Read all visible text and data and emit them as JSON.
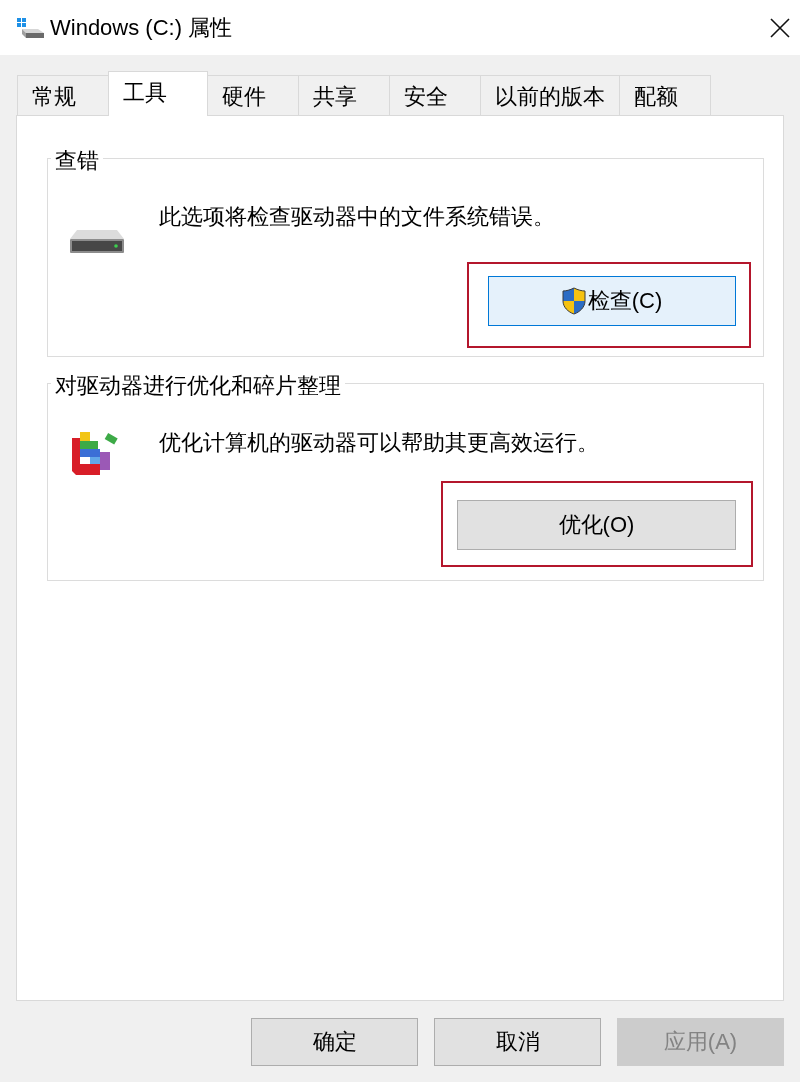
{
  "window": {
    "title": "Windows (C:) 属性"
  },
  "tabs": [
    {
      "label": "常规",
      "selected": false
    },
    {
      "label": "工具",
      "selected": true
    },
    {
      "label": "硬件",
      "selected": false
    },
    {
      "label": "共享",
      "selected": false
    },
    {
      "label": "安全",
      "selected": false
    },
    {
      "label": "以前的版本",
      "selected": false
    },
    {
      "label": "配额",
      "selected": false
    }
  ],
  "groups": [
    {
      "kind": "check",
      "title": "查错",
      "description": "此选项将检查驱动器中的文件系统错误。",
      "button": {
        "label": "检查(C)",
        "focused": true,
        "elevated": true,
        "highlighted": true
      }
    },
    {
      "kind": "optimize",
      "title": "对驱动器进行优化和碎片整理",
      "description": "优化计算机的驱动器可以帮助其更高效运行。",
      "button": {
        "label": "优化(O)",
        "focused": false,
        "elevated": false,
        "highlighted": true
      }
    }
  ],
  "buttons": [
    {
      "label": "确定",
      "disabled": false
    },
    {
      "label": "取消",
      "disabled": false
    },
    {
      "label": "应用(A)",
      "disabled": true
    }
  ]
}
